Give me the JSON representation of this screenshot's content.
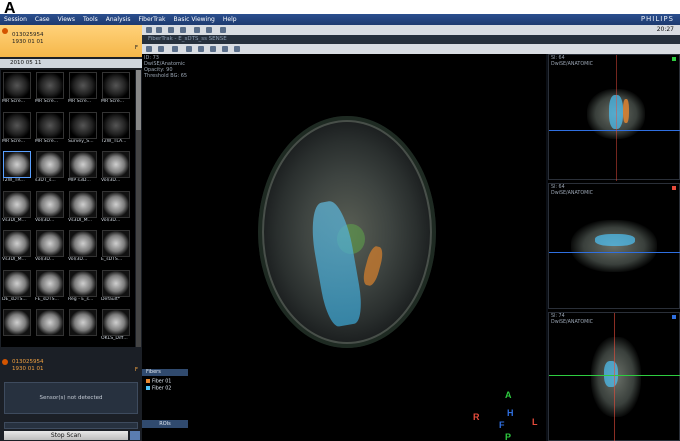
{
  "panel_label": "A",
  "menubar": {
    "items": [
      "Session",
      "Case",
      "Views",
      "Tools",
      "Analysis",
      "FiberTrak",
      "Basic Viewing",
      "Help"
    ],
    "brand": "PHILIPS"
  },
  "patient": {
    "id": "013025954",
    "date": "1930 01 01",
    "sex": "F"
  },
  "study_date": "2010 05 11",
  "thumbnails": [
    {
      "label": "MR Scre..."
    },
    {
      "label": "MR Scre..."
    },
    {
      "label": "MR Scre..."
    },
    {
      "label": "MR Scre..."
    },
    {
      "label": "MR Scre..."
    },
    {
      "label": "MR Scre..."
    },
    {
      "label": "Survey_S..."
    },
    {
      "label": "T2W_TLA..."
    },
    {
      "label": "T2W_TR..."
    },
    {
      "label": "s3DT_s..."
    },
    {
      "label": "MIP s3D..."
    },
    {
      "label": "Vol/3D..."
    },
    {
      "label": "Vs3DI_M..."
    },
    {
      "label": "Vol/3D..."
    },
    {
      "label": "Vs3DI_M..."
    },
    {
      "label": "Vol/3D..."
    },
    {
      "label": "Vs3DI_M..."
    },
    {
      "label": "Vol/3D..."
    },
    {
      "label": "Vol/3D..."
    },
    {
      "label": "E_sDTS..."
    },
    {
      "label": "DE_sDTS..."
    },
    {
      "label": "FE_sDTS..."
    },
    {
      "label": "Reg - E_s..."
    },
    {
      "label": "Default*"
    },
    {
      "label": ""
    },
    {
      "label": ""
    },
    {
      "label": ""
    },
    {
      "label": "OKLS_Diff..."
    }
  ],
  "patient_bottom": {
    "id": "013025954",
    "date": "1930 01 01",
    "sex": "F"
  },
  "sensor_message": "Sensor(s) not detected",
  "stop_button": "Stop Scan",
  "clock": "20:27",
  "viewer_title": "FiberTrak - E_sDTS_ss SENSE",
  "main_info": [
    "ID: 73",
    "DwiSE/Anatomic",
    "Opacity: 90",
    "Threshold BG: 65"
  ],
  "fibers_legend": {
    "header": "Fibers",
    "items": [
      {
        "label": "Fiber 01",
        "color": "#e8872f"
      },
      {
        "label": "Fiber 02",
        "color": "#4fc3f7"
      }
    ]
  },
  "roi_label": "ROIs",
  "orientation": {
    "A": "A",
    "R": "R",
    "L": "L",
    "H": "H",
    "F": "F",
    "P": "P"
  },
  "side_views": [
    {
      "title": "Sl: 64",
      "subtitle": "DwiSE/ANATOMIC",
      "marker_color": "#2ecc40"
    },
    {
      "title": "Sl: 64",
      "subtitle": "DwiSE/ANATOMIC",
      "marker_color": "#e74c3c"
    },
    {
      "title": "Sl: 74",
      "subtitle": "DwiSE/ANATOMIC",
      "marker_color": "#2f6fe0"
    }
  ]
}
